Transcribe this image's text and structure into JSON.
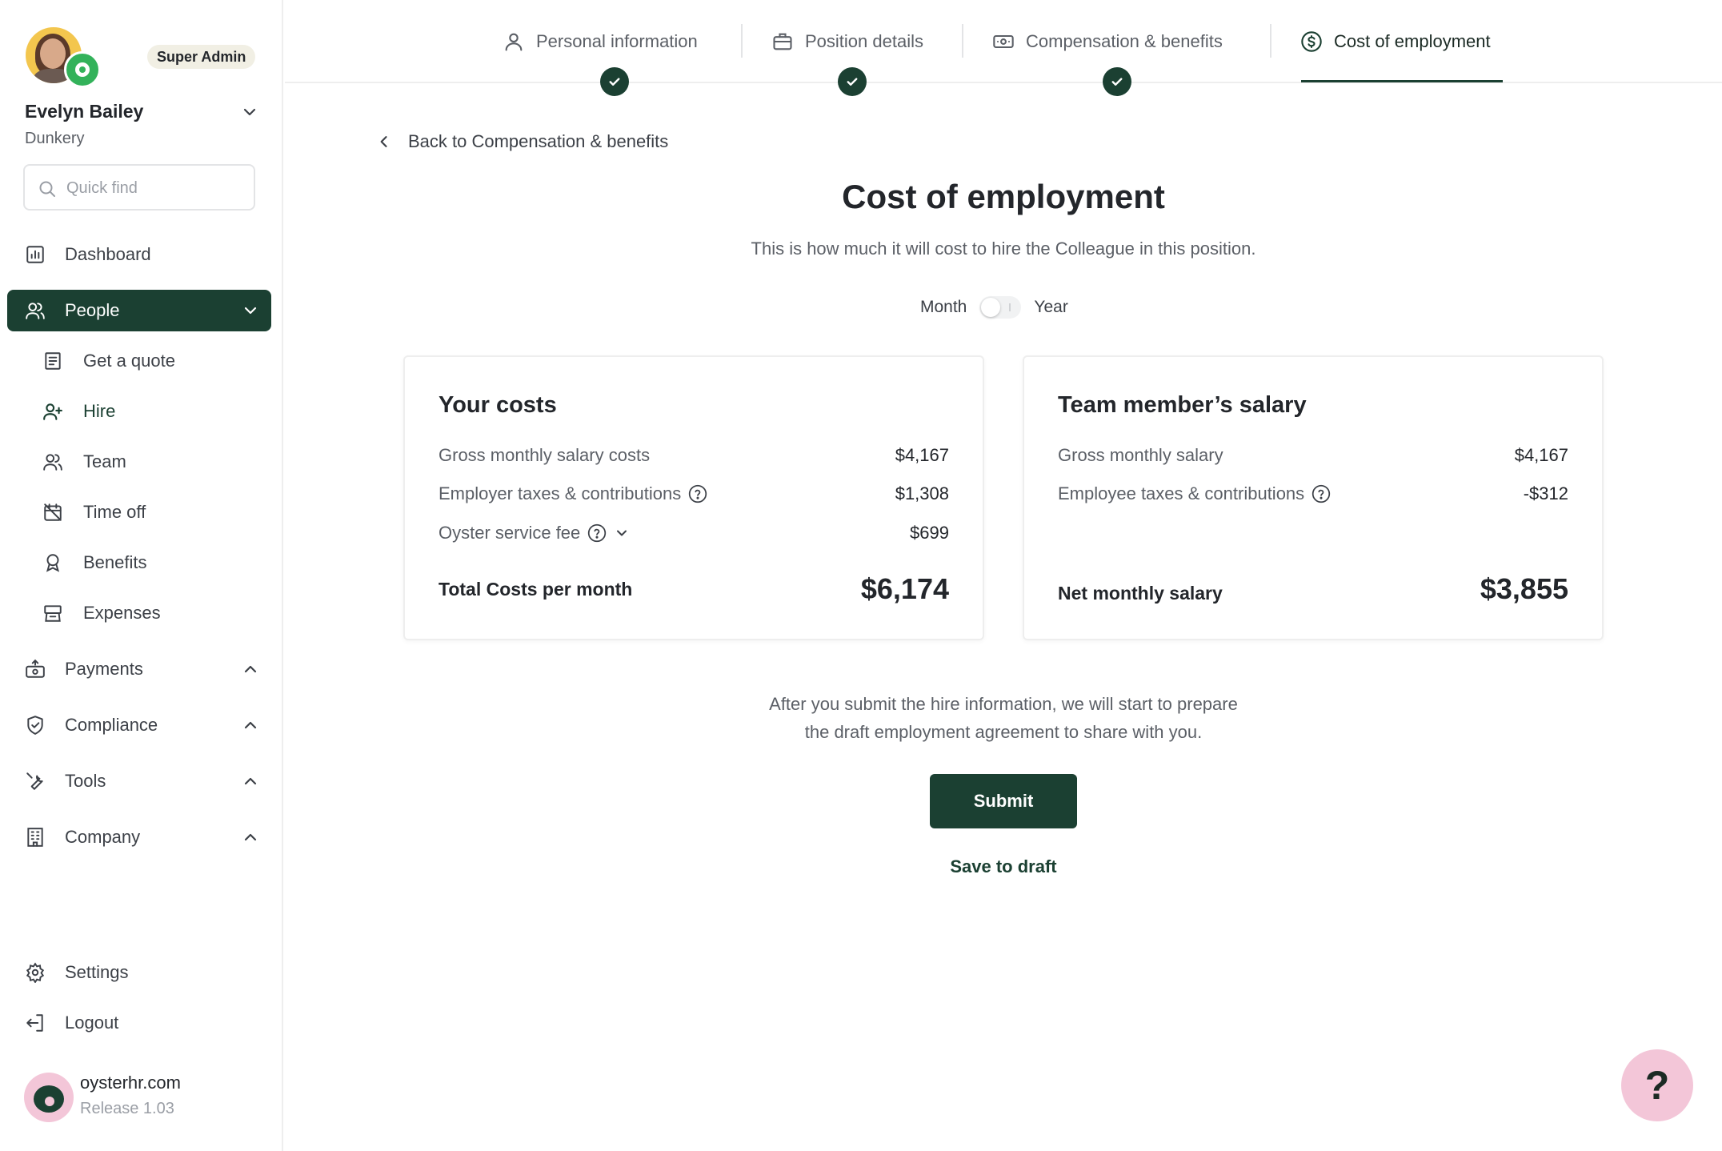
{
  "user": {
    "name": "Evelyn Bailey",
    "company": "Dunkery",
    "role": "Super Admin"
  },
  "search": {
    "placeholder": "Quick find"
  },
  "sidebar": {
    "items": [
      {
        "label": "Dashboard",
        "icon": "chart-bar-icon"
      },
      {
        "label": "People",
        "icon": "users-icon",
        "active": true,
        "expanded": true
      },
      {
        "label": "Payments",
        "icon": "money-hand-icon"
      },
      {
        "label": "Compliance",
        "icon": "shield-check-icon"
      },
      {
        "label": "Tools",
        "icon": "wrench-icon"
      },
      {
        "label": "Company",
        "icon": "building-icon"
      }
    ],
    "people_sub": [
      {
        "label": "Get a quote",
        "icon": "receipt-icon"
      },
      {
        "label": "Hire",
        "icon": "user-plus-icon",
        "active": true
      },
      {
        "label": "Team",
        "icon": "users-icon"
      },
      {
        "label": "Time off",
        "icon": "calendar-off-icon"
      },
      {
        "label": "Benefits",
        "icon": "award-icon"
      },
      {
        "label": "Expenses",
        "icon": "cash-register-icon"
      }
    ],
    "bottom": [
      {
        "label": "Settings",
        "icon": "gear-icon"
      },
      {
        "label": "Logout",
        "icon": "logout-icon"
      }
    ],
    "brand": {
      "name": "oysterhr.com",
      "release": "Release 1.03"
    }
  },
  "stepper": {
    "steps": [
      {
        "label": "Personal information",
        "icon": "person-icon",
        "completed": true
      },
      {
        "label": "Position details",
        "icon": "briefcase-icon",
        "completed": true
      },
      {
        "label": "Compensation & benefits",
        "icon": "banknote-icon",
        "completed": true
      },
      {
        "label": "Cost of employment",
        "icon": "dollar-circle-icon",
        "current": true
      }
    ]
  },
  "main": {
    "back_label": "Back to Compensation & benefits",
    "title": "Cost of employment",
    "subtitle": "This is how much it will cost to hire the Colleague in this position.",
    "toggle": {
      "left": "Month",
      "right": "Year",
      "selected": "Month"
    },
    "your_costs": {
      "title": "Your costs",
      "rows": [
        {
          "label": "Gross monthly salary costs",
          "value": "$4,167"
        },
        {
          "label": "Employer taxes & contributions",
          "value": "$1,308"
        },
        {
          "label": "Oyster service fee",
          "value": "$699"
        }
      ],
      "total_label": "Total Costs per month",
      "total_value": "$6,174"
    },
    "salary": {
      "title": "Team member’s salary",
      "rows": [
        {
          "label": "Gross monthly salary",
          "value": "$4,167"
        },
        {
          "label": "Employee taxes & contributions",
          "value": "-$312"
        }
      ],
      "total_label": "Net monthly salary",
      "total_value": "$3,855"
    },
    "info_line1": "After you submit the hire information, we will start to prepare",
    "info_line2": "the draft employment agreement to share with you.",
    "submit_label": "Submit",
    "draft_label": "Save to draft"
  },
  "help": {
    "label": "?"
  },
  "colors": {
    "primary": "#1b4032",
    "accent_pink": "#f3c6d8",
    "badge_green": "#33b25a"
  }
}
